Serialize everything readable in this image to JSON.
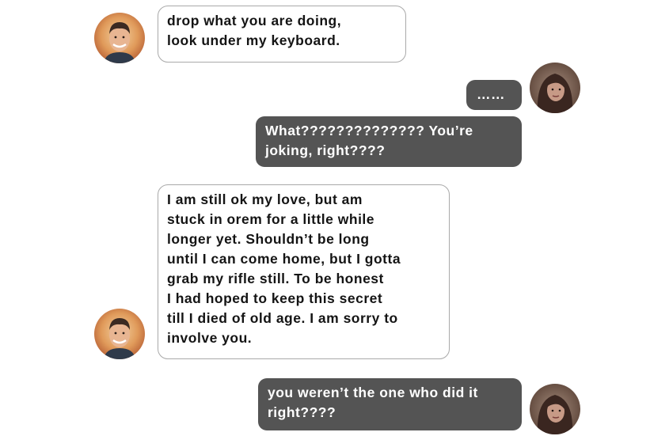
{
  "conversation": {
    "messages": [
      {
        "sender": "incoming",
        "avatar": "young-man-avatar",
        "text": "drop what you are doing,\nlook under my keyboard."
      },
      {
        "sender": "outgoing",
        "avatar": "woman-avatar",
        "text": "……"
      },
      {
        "sender": "outgoing",
        "text": "What?????????????? You’re\njoking, right????"
      },
      {
        "sender": "incoming",
        "avatar": "young-man-avatar",
        "text": "I am still ok my love, but am\nstuck in orem for a little while\nlonger yet. Shouldn’t be long\nuntil I can come home, but I gotta\ngrab my rifle still. To be honest\nI had hoped to keep this secret\ntill I died of old age. I am sorry to\ninvolve you."
      },
      {
        "sender": "outgoing",
        "avatar": "woman-avatar",
        "text": "you weren’t the one who did it\nright????"
      }
    ]
  },
  "colors": {
    "outgoing_bubble": "#545454",
    "incoming_border": "#a9a9a9",
    "background": "#ffffff"
  }
}
